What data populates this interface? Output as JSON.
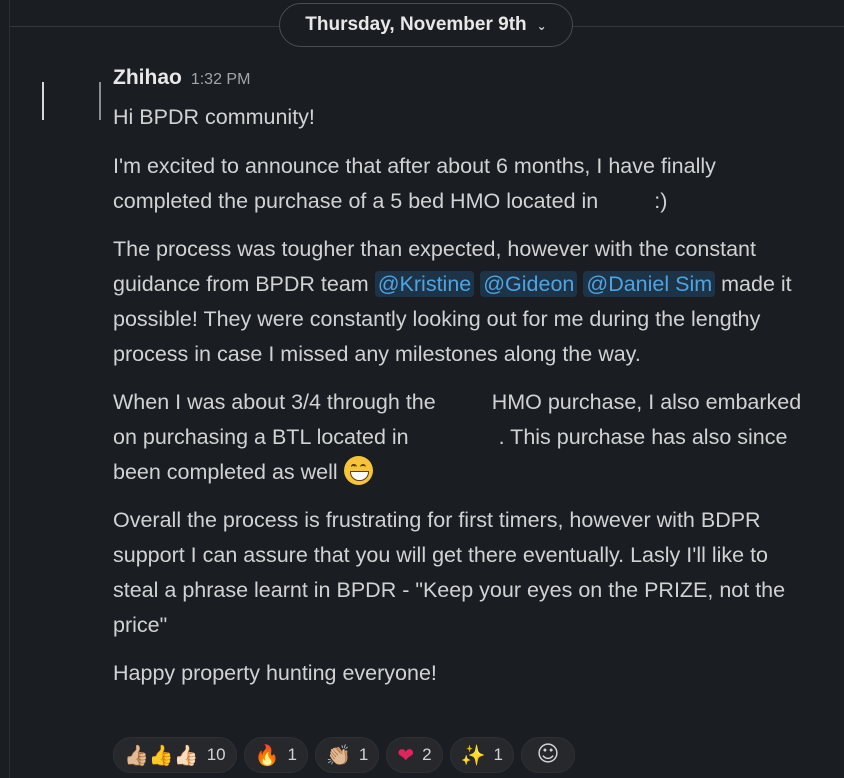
{
  "divider": {
    "date_label": "Thursday, November 9th"
  },
  "message": {
    "author": "Zhihao",
    "timestamp": "1:32 PM",
    "p1": "Hi BPDR community!",
    "p2a": "I'm excited to announce that after about 6 months, I have finally completed the purchase of a 5 bed HMO located in",
    "p2b": ":)",
    "p3a": "The process was tougher than expected, however with the constant guidance from BPDR team",
    "mention1": "@Kristine",
    "mention2": "@Gideon",
    "mention3": "@Daniel Sim",
    "p3b": "made it possible! They were constantly looking out for me during the lengthy process in case I missed any milestones along the way.",
    "p4a": "When I was about 3/4 through the",
    "p4b": "HMO purchase,  I also embarked on purchasing a BTL located in",
    "p4c": ". This purchase has also since been completed as well",
    "p5": "Overall the process is frustrating for first timers, however with BDPR support I can assure that you will get there eventually. Lasly I'll like to steal a phrase learnt in BPDR - \"Keep your eyes on the PRIZE, not the price\"",
    "p6": "Happy property hunting everyone!"
  },
  "reactions": [
    {
      "icon": "thumbs-up-icons",
      "emoji": "👍🏼👍👍🏻",
      "count": "10"
    },
    {
      "icon": "fire-icon",
      "emoji": "🔥",
      "count": "1"
    },
    {
      "icon": "clap-icon",
      "emoji": "👏🏼",
      "count": "1"
    },
    {
      "icon": "heart-icon",
      "emoji": "❤",
      "count": "2"
    },
    {
      "icon": "sparkles-icon",
      "emoji": "✨",
      "count": "1"
    }
  ],
  "add_reaction_icon": "☺",
  "colors": {
    "background": "#1a1d21",
    "mention_text": "#4fa3e0",
    "mention_bg": "#1d3448"
  }
}
